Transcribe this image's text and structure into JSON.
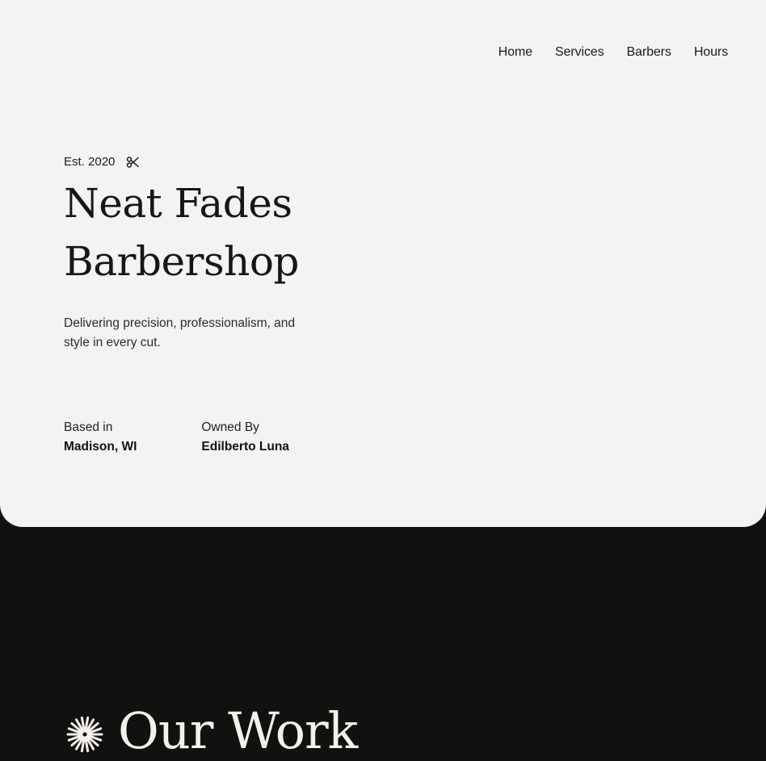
{
  "nav": {
    "items": [
      "Home",
      "Services",
      "Barbers",
      "Hours"
    ]
  },
  "hero": {
    "est": "Est. 2020",
    "est_icon": "scissors-icon",
    "title_line1": "Neat Fades",
    "title_line2": "Barbershop",
    "tagline": "Delivering precision, professionalism, and style in every cut.",
    "based_label": "Based in",
    "based_value": "Madison, WI",
    "owned_label": "Owned By",
    "owned_value": "Edilberto Luna"
  },
  "work": {
    "icon": "burst-icon",
    "title": "Our Work"
  },
  "colors": {
    "hero_background": "#f4f3f1",
    "dark_background": "#111110",
    "text_dark": "#161616",
    "text_light": "#f4f1ea"
  }
}
